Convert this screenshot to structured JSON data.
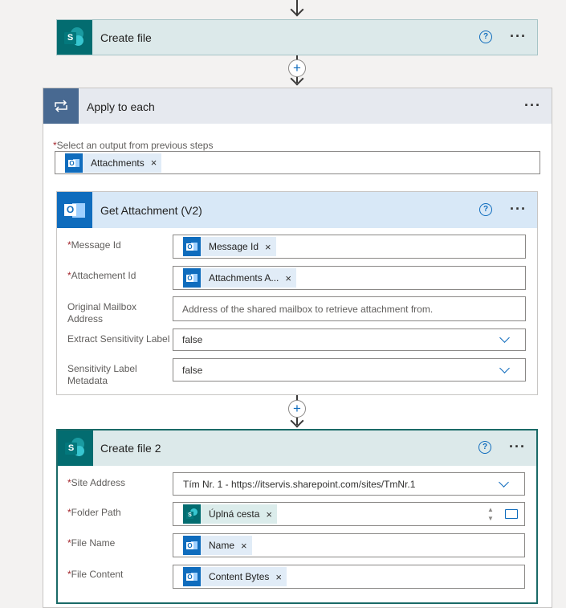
{
  "create_file": {
    "title": "Create file"
  },
  "apply_to_each": {
    "title": "Apply to each",
    "select_label": "Select an output from previous steps",
    "token": "Attachments"
  },
  "get_attachment": {
    "title": "Get Attachment (V2)",
    "fields": [
      {
        "label": "Message Id",
        "required": true,
        "token": "Message Id"
      },
      {
        "label": "Attachement Id",
        "required": true,
        "token": "Attachments A..."
      },
      {
        "label_line1": "Original Mailbox",
        "label_line2": "Address",
        "required": false,
        "placeholder": "Address of the shared mailbox to retrieve attachment from."
      },
      {
        "label": "Extract Sensitivity Label",
        "required": false,
        "value": "false"
      },
      {
        "label_line1": "Sensitivity Label",
        "label_line2": "Metadata",
        "required": false,
        "value": "false"
      }
    ]
  },
  "create_file_2": {
    "title": "Create file 2",
    "fields": [
      {
        "label": "Site Address",
        "required": true,
        "value": "Tím Nr. 1 - https://itservis.sharepoint.com/sites/TmNr.1"
      },
      {
        "label": "Folder Path",
        "required": true,
        "token": "Úplná cesta"
      },
      {
        "label": "File Name",
        "required": true,
        "token": "Name"
      },
      {
        "label": "File Content",
        "required": true,
        "token": "Content Bytes"
      }
    ]
  },
  "icons": {
    "help": "?",
    "more": "···",
    "plus": "+",
    "remove": "×",
    "required": "*"
  },
  "colors": {
    "sharepoint": "#036c70",
    "outlook": "#0f6cbd",
    "loop_header": "#e6e9ef",
    "accent": "#0f6cbd"
  }
}
